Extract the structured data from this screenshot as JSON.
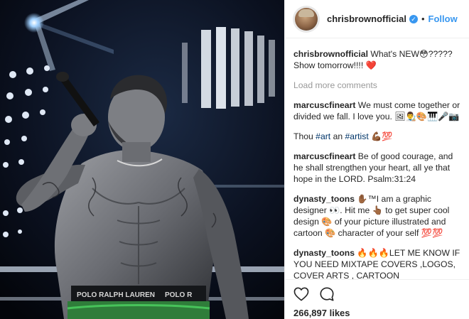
{
  "post": {
    "username": "chrisbrownofficial",
    "verified_icon": "verified-badge-icon",
    "separator": "•",
    "follow_label": "Follow",
    "caption": {
      "user": "chrisbrownofficial",
      "text": "What's NEW😳????? Show tomorrow!!!! ❤️"
    },
    "load_more_label": "Load more comments",
    "comments": [
      {
        "user": "marcuscfineart",
        "text": "We must come together or divided we fall. I love you. 🖼👨‍🎨🎨🎹🎤📷"
      },
      {
        "user": "",
        "text_pre": "Thou ",
        "tag1": "#art",
        "text_mid": " an ",
        "tag2": "#artist",
        "text_post": " 💪🏾💯"
      },
      {
        "user": "marcuscfineart",
        "text": "Be of good courage, and he shall strengthen your heart, all ye that hope in the LORD. Psalm:31:24"
      },
      {
        "user": "dynasty_toons",
        "text": "✋🏾™I am a graphic designer 👀. Hit me 👆🏾 to get super cool design 🎨 of your picture illustrated and cartoon 🎨 character of your self 💯💯"
      },
      {
        "user": "dynasty_toons",
        "text": "🔥🔥🔥LET ME KNOW IF YOU NEED MIXTAPE COVERS ,LOGOS, COVER ARTS , CARTOON PICS,ANIMATED VIDEO AT AFFORDABLE PRICES📸🎹📸📸"
      }
    ],
    "likes": "266,897 likes",
    "icons": {
      "like": "heart-icon",
      "comment": "comment-icon"
    }
  }
}
